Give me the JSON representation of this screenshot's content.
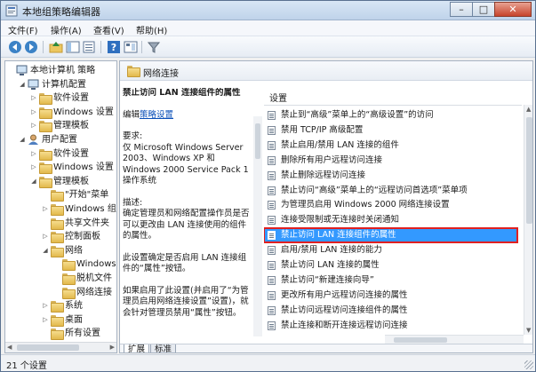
{
  "window": {
    "title": "本地组策略编辑器",
    "controls": {
      "minimize": "–",
      "maximize": "□",
      "close": "✕"
    }
  },
  "menu": [
    "文件(F)",
    "操作(A)",
    "查看(V)",
    "帮助(H)"
  ],
  "toolbar_icons": [
    "back-arrow-icon",
    "forward-arrow-icon",
    "up-folder-icon",
    "show-tree-icon",
    "export-list-icon",
    "help-icon",
    "properties-icon",
    "filter-icon"
  ],
  "tree": [
    {
      "label": "本地计算机 策略",
      "icon": "computer-monitor-icon",
      "level": 0,
      "arrow": ""
    },
    {
      "label": "计算机配置",
      "icon": "computer-icon",
      "level": 1,
      "arrow": "◢"
    },
    {
      "label": "软件设置",
      "icon": "folder-icon",
      "level": 2,
      "arrow": "▷"
    },
    {
      "label": "Windows 设置",
      "icon": "folder-icon",
      "level": 2,
      "arrow": "▷"
    },
    {
      "label": "管理模板",
      "icon": "folder-icon",
      "level": 2,
      "arrow": "▷"
    },
    {
      "label": "用户配置",
      "icon": "user-icon",
      "level": 1,
      "arrow": "◢"
    },
    {
      "label": "软件设置",
      "icon": "folder-icon",
      "level": 2,
      "arrow": "▷"
    },
    {
      "label": "Windows 设置",
      "icon": "folder-icon",
      "level": 2,
      "arrow": "▷"
    },
    {
      "label": "管理模板",
      "icon": "folder-icon",
      "level": 2,
      "arrow": "◢"
    },
    {
      "label": "\"开始\"菜单",
      "icon": "folder-icon",
      "level": 3,
      "arrow": ""
    },
    {
      "label": "Windows 组件",
      "icon": "folder-icon",
      "level": 3,
      "arrow": "▷"
    },
    {
      "label": "共享文件夹",
      "icon": "folder-icon",
      "level": 3,
      "arrow": ""
    },
    {
      "label": "控制面板",
      "icon": "folder-icon",
      "level": 3,
      "arrow": "▷"
    },
    {
      "label": "网络",
      "icon": "folder-icon",
      "level": 3,
      "arrow": "◢"
    },
    {
      "label": "Windows",
      "icon": "folder-icon",
      "level": 4,
      "arrow": ""
    },
    {
      "label": "脱机文件",
      "icon": "folder-icon",
      "level": 4,
      "arrow": ""
    },
    {
      "label": "网络连接",
      "icon": "folder-icon",
      "level": 4,
      "arrow": ""
    },
    {
      "label": "系统",
      "icon": "folder-icon",
      "level": 3,
      "arrow": "▷"
    },
    {
      "label": "桌面",
      "icon": "folder-icon",
      "level": 3,
      "arrow": "▷"
    },
    {
      "label": "所有设置",
      "icon": "folder-icon",
      "level": 3,
      "arrow": ""
    }
  ],
  "content": {
    "header_title": "网络连接",
    "description": {
      "title": "禁止访问 LAN 连接组件的属性",
      "edit_prefix": "编辑",
      "edit_link": "策略设置",
      "requirements_label": "要求:",
      "requirements_text": "仅 Microsoft Windows Server 2003、Windows XP 和 Windows 2000 Service Pack 1 操作系统",
      "description_label": "描述:",
      "description_text": "确定管理员和网络配置操作员是否可以更改由 LAN 连接使用的组件的属性。",
      "paragraph_2": "此设置确定是否启用 LAN 连接组件的“属性”按钮。",
      "paragraph_3": "如果启用了此设置(并启用了“为管理员启用网络连接设置”设置)，就会针对管理员禁用“属性”按钮。"
    },
    "list_header": "设置",
    "policies": [
      "禁止到“高级”菜单上的“高级设置”的访问",
      "禁用 TCP/IP 高级配置",
      "禁止启用/禁用 LAN 连接的组件",
      "删除所有用户远程访问连接",
      "禁止删除远程访问连接",
      "禁止访问“高级”菜单上的“远程访问首选项”菜单项",
      "为管理员启用 Windows 2000 网络连接设置",
      "连接受限制或无连接时关闭通知",
      "禁止访问 LAN 连接组件的属性",
      "启用/禁用 LAN 连接的能力",
      "禁止访问 LAN 连接的属性",
      "禁止访问“新建连接向导”",
      "更改所有用户远程访问连接的属性",
      "禁止访问远程访问连接组件的属性",
      "禁止连接和断开连接远程访问连接"
    ],
    "selected_index": 8
  },
  "tabs": [
    "扩展",
    "标准"
  ],
  "status": {
    "text": "21 个设置"
  },
  "colors": {
    "selection": "#3399ff",
    "highlight_border": "#e02020",
    "link": "#0a4fb8"
  }
}
